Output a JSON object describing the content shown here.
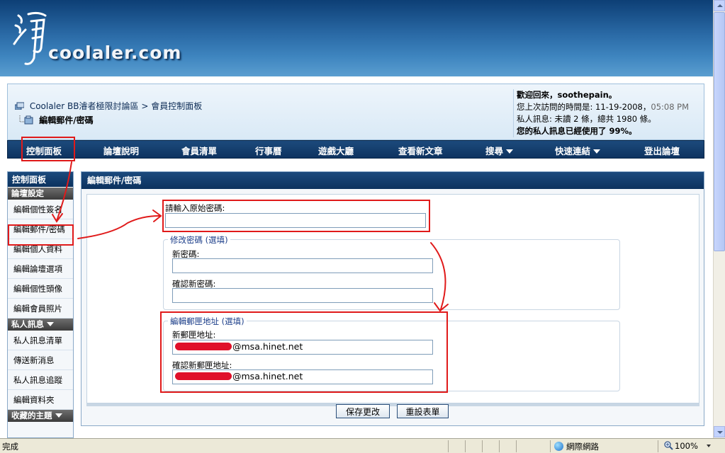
{
  "brand": {
    "logo_text": "coolaler.com"
  },
  "breadcrumb": {
    "root": "Coolaler BB濬者極限討論區",
    "separator": ">",
    "current": "會員控制面板"
  },
  "page_title": "編輯郵件/密碼",
  "welcome": {
    "greeting": "歡迎回來，soothepain。",
    "last_visit_label": "您上次訪問的時間是: 11-19-2008，",
    "last_visit_time": "05:08 PM",
    "pm_status": "私人訊息: 未讀 2 條，總共 1980 條。",
    "pm_usage": "您的私人訊息已經使用了 99%。"
  },
  "nav": {
    "items": [
      {
        "label": "控制面板"
      },
      {
        "label": "論壇說明"
      },
      {
        "label": "會員清單"
      },
      {
        "label": "行事曆"
      },
      {
        "label": "遊戲大廳"
      },
      {
        "label": "查看新文章"
      },
      {
        "label": "搜尋"
      },
      {
        "label": "快速連結"
      },
      {
        "label": "登出論壇"
      }
    ]
  },
  "sidebar": {
    "header": "控制面板",
    "section_settings": "論壇設定",
    "settings_items": [
      {
        "label": "編輯個性簽名"
      },
      {
        "label": "編輯郵件/密碼"
      },
      {
        "label": "編輯個人資料"
      },
      {
        "label": "編輯論壇選項"
      },
      {
        "label": "編輯個性頭像"
      },
      {
        "label": "編輯會員照片"
      }
    ],
    "section_pm": "私人訊息",
    "pm_items": [
      {
        "label": "私人訊息清單"
      },
      {
        "label": "傳送新消息"
      },
      {
        "label": "私人訊息追蹤"
      },
      {
        "label": "編輯資料夾"
      }
    ],
    "section_subscribed": "收藏的主題"
  },
  "form": {
    "header": "編輯郵件/密碼",
    "current_password_label": "請輸入原始密碼:",
    "current_password_value": "",
    "change_password_legend": "修改密碼 (選填)",
    "new_password_label": "新密碼:",
    "new_password_value": "",
    "confirm_password_label": "確認新密碼:",
    "confirm_password_value": "",
    "email_legend": "編輯郵匣地址 (選填)",
    "new_email_label": "新郵匣地址:",
    "new_email_domain": "@msa.hinet.net",
    "confirm_email_label": "確認新郵匣地址:",
    "confirm_email_domain": "@msa.hinet.net",
    "save_button": "保存更改",
    "reset_button": "重設表單"
  },
  "statusbar": {
    "status": "完成",
    "zone": "網際網路",
    "zoom": "100%"
  },
  "colors": {
    "nav_bg": "#0e3360",
    "banner": "#2a6aa6",
    "annotation_red": "#e01a1a",
    "legend_blue": "#1d3f8a"
  }
}
